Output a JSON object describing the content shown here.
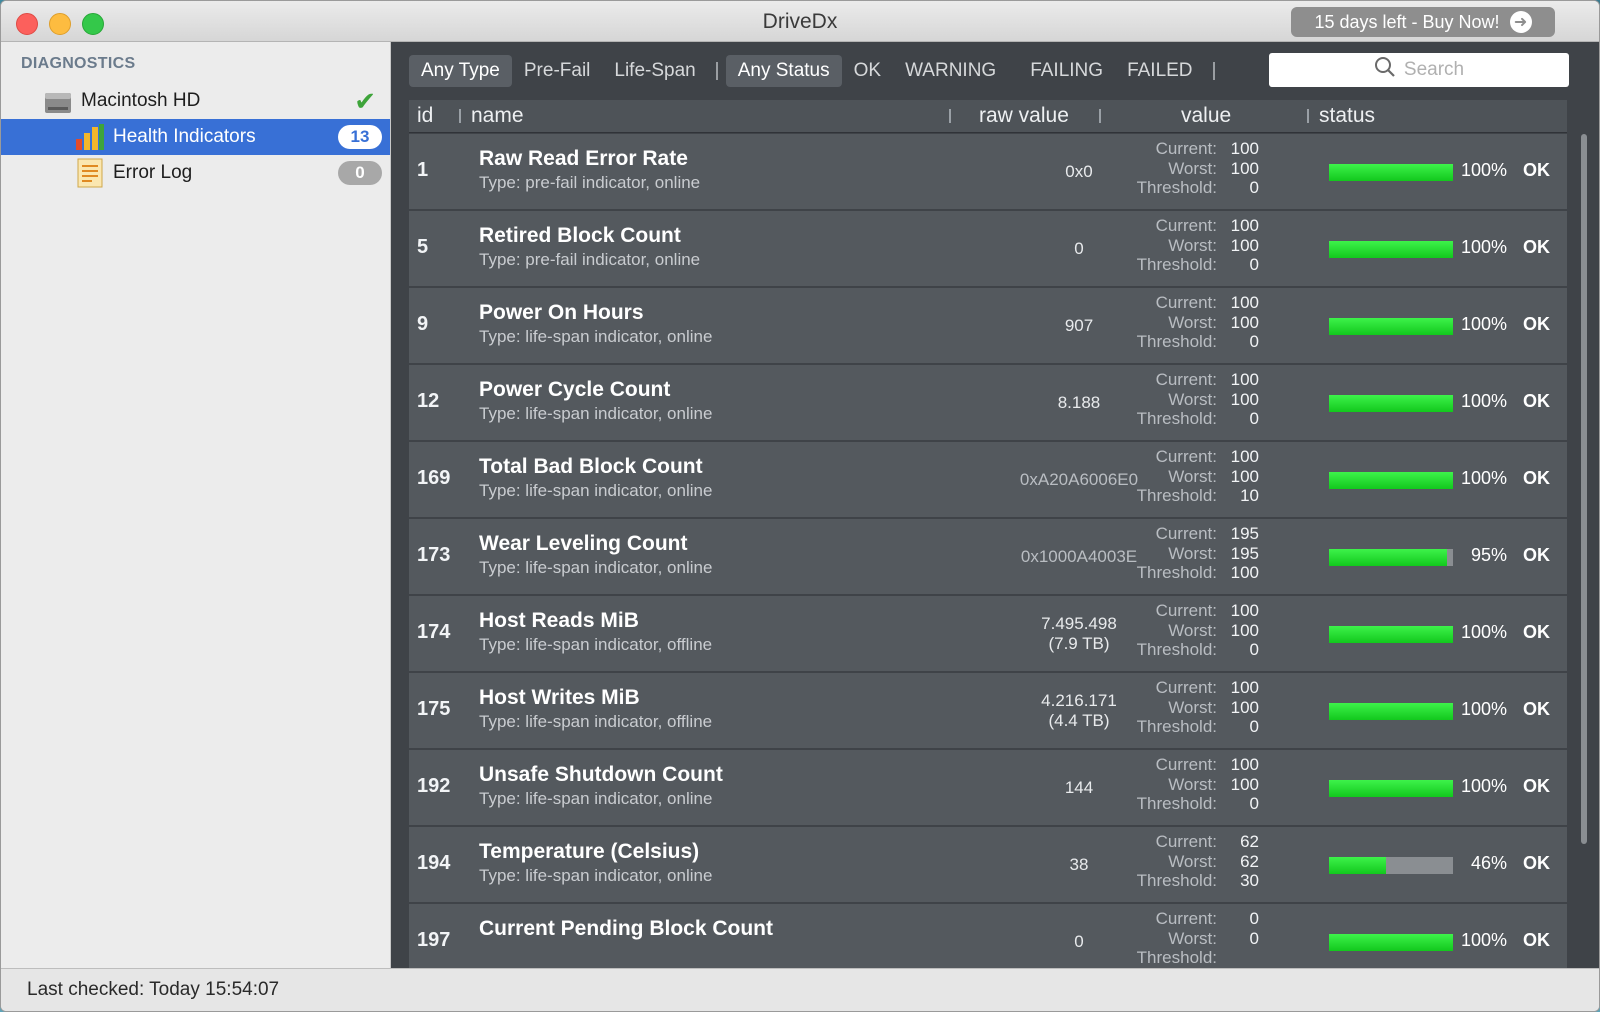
{
  "window": {
    "title": "DriveDx",
    "trial_label": "15 days left - Buy Now!"
  },
  "sidebar": {
    "heading": "DIAGNOSTICS",
    "drive": {
      "label": "Macintosh HD",
      "status_icon": "checkmark-icon"
    },
    "items": [
      {
        "label": "Health Indicators",
        "badge": "13",
        "icon": "bar-chart-icon",
        "selected": true
      },
      {
        "label": "Error Log",
        "badge": "0",
        "icon": "document-icon",
        "selected": false
      }
    ]
  },
  "filters": {
    "type": [
      "Any Type",
      "Pre-Fail",
      "Life-Span"
    ],
    "status": [
      "Any Status",
      "OK",
      "WARNING",
      "FAILING",
      "FAILED"
    ],
    "active_type": "Any Type",
    "active_status": "Any Status"
  },
  "search": {
    "placeholder": "Search"
  },
  "columns": {
    "id": "id",
    "name": "name",
    "raw": "raw value",
    "value": "value",
    "status": "status"
  },
  "value_labels": {
    "current": "Current:",
    "worst": "Worst:",
    "threshold": "Threshold:"
  },
  "rows": [
    {
      "id": "1",
      "name": "Raw Read Error Rate",
      "type": "Type: pre-fail indicator, online",
      "raw": "0x0",
      "raw2": "",
      "current": "100",
      "worst": "100",
      "threshold": "0",
      "pct": "100%",
      "level": 1.0,
      "status": "OK"
    },
    {
      "id": "5",
      "name": "Retired Block Count",
      "type": "Type: pre-fail indicator, online",
      "raw": "0",
      "raw2": "",
      "current": "100",
      "worst": "100",
      "threshold": "0",
      "pct": "100%",
      "level": 1.0,
      "status": "OK"
    },
    {
      "id": "9",
      "name": "Power On Hours",
      "type": "Type: life-span indicator, online",
      "raw": "907",
      "raw2": "",
      "current": "100",
      "worst": "100",
      "threshold": "0",
      "pct": "100%",
      "level": 1.0,
      "status": "OK"
    },
    {
      "id": "12",
      "name": "Power Cycle Count",
      "type": "Type: life-span indicator, online",
      "raw": "8.188",
      "raw2": "",
      "current": "100",
      "worst": "100",
      "threshold": "0",
      "pct": "100%",
      "level": 1.0,
      "status": "OK"
    },
    {
      "id": "169",
      "name": "Total Bad Block Count",
      "type": "Type: life-span indicator, online",
      "raw": "0xA20A6006E0",
      "raw2": "",
      "current": "100",
      "worst": "100",
      "threshold": "10",
      "pct": "100%",
      "level": 1.0,
      "status": "OK"
    },
    {
      "id": "173",
      "name": "Wear Leveling Count",
      "type": "Type: life-span indicator, online",
      "raw": "0x1000A4003E",
      "raw2": "",
      "current": "195",
      "worst": "195",
      "threshold": "100",
      "pct": "95%",
      "level": 0.95,
      "status": "OK"
    },
    {
      "id": "174",
      "name": "Host Reads MiB",
      "type": "Type: life-span indicator, offline",
      "raw": "7.495.498",
      "raw2": "(7.9 TB)",
      "current": "100",
      "worst": "100",
      "threshold": "0",
      "pct": "100%",
      "level": 1.0,
      "status": "OK"
    },
    {
      "id": "175",
      "name": "Host Writes MiB",
      "type": "Type: life-span indicator, offline",
      "raw": "4.216.171",
      "raw2": "(4.4 TB)",
      "current": "100",
      "worst": "100",
      "threshold": "0",
      "pct": "100%",
      "level": 1.0,
      "status": "OK"
    },
    {
      "id": "192",
      "name": "Unsafe Shutdown Count",
      "type": "Type: life-span indicator, online",
      "raw": "144",
      "raw2": "",
      "current": "100",
      "worst": "100",
      "threshold": "0",
      "pct": "100%",
      "level": 1.0,
      "status": "OK"
    },
    {
      "id": "194",
      "name": "Temperature (Celsius)",
      "type": "Type: life-span indicator, online",
      "raw": "38",
      "raw2": "",
      "current": "62",
      "worst": "62",
      "threshold": "30",
      "pct": "46%",
      "level": 0.46,
      "status": "OK"
    },
    {
      "id": "197",
      "name": "Current Pending Block Count",
      "type": "",
      "raw": "0",
      "raw2": "",
      "current": "0",
      "worst": "0",
      "threshold": "",
      "pct": "100%",
      "level": 1.0,
      "status": "OK"
    }
  ],
  "statusbar": {
    "text": "Last checked: Today 15:54:07"
  }
}
